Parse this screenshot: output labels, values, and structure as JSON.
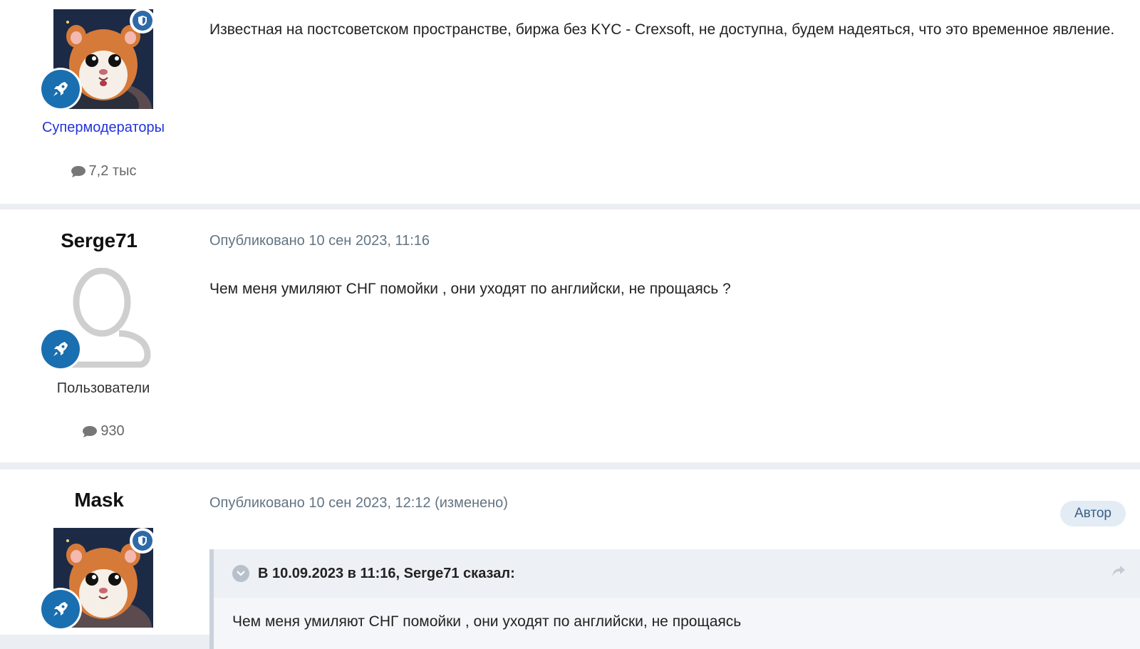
{
  "posts": [
    {
      "group": "Супермодераторы",
      "post_count": "7,2 тыс",
      "text": "Известная на постсоветском пространстве, биржа без KYC - Crexsoft, не доступна, будем надеяться, что это временное явление."
    },
    {
      "author": "Serge71",
      "meta": "Опубликовано 10 сен 2023, 11:16",
      "group": "Пользователи",
      "post_count": "930",
      "text": "Чем меня умиляют СНГ помойки , они уходят по английски, не прощаясь ?"
    },
    {
      "author": "Mask",
      "meta": "Опубликовано 10 сен 2023, 12:12 (изменено)",
      "badge": "Автор",
      "quote": {
        "header": "В 10.09.2023 в 11:16, Serge71 сказал:",
        "text": "Чем меня умиляют СНГ помойки , они уходят по английски, не прощаясь"
      }
    }
  ],
  "colors": {
    "moderator_group": "#2233dd",
    "rank_badge": "#1a6fb0",
    "shield_badge": "#2e6aa8",
    "meta_text": "#627483"
  },
  "icons": [
    "shield-icon",
    "rocket-icon",
    "comment-icon",
    "chevron-down-icon",
    "share-icon",
    "default-user-avatar"
  ]
}
